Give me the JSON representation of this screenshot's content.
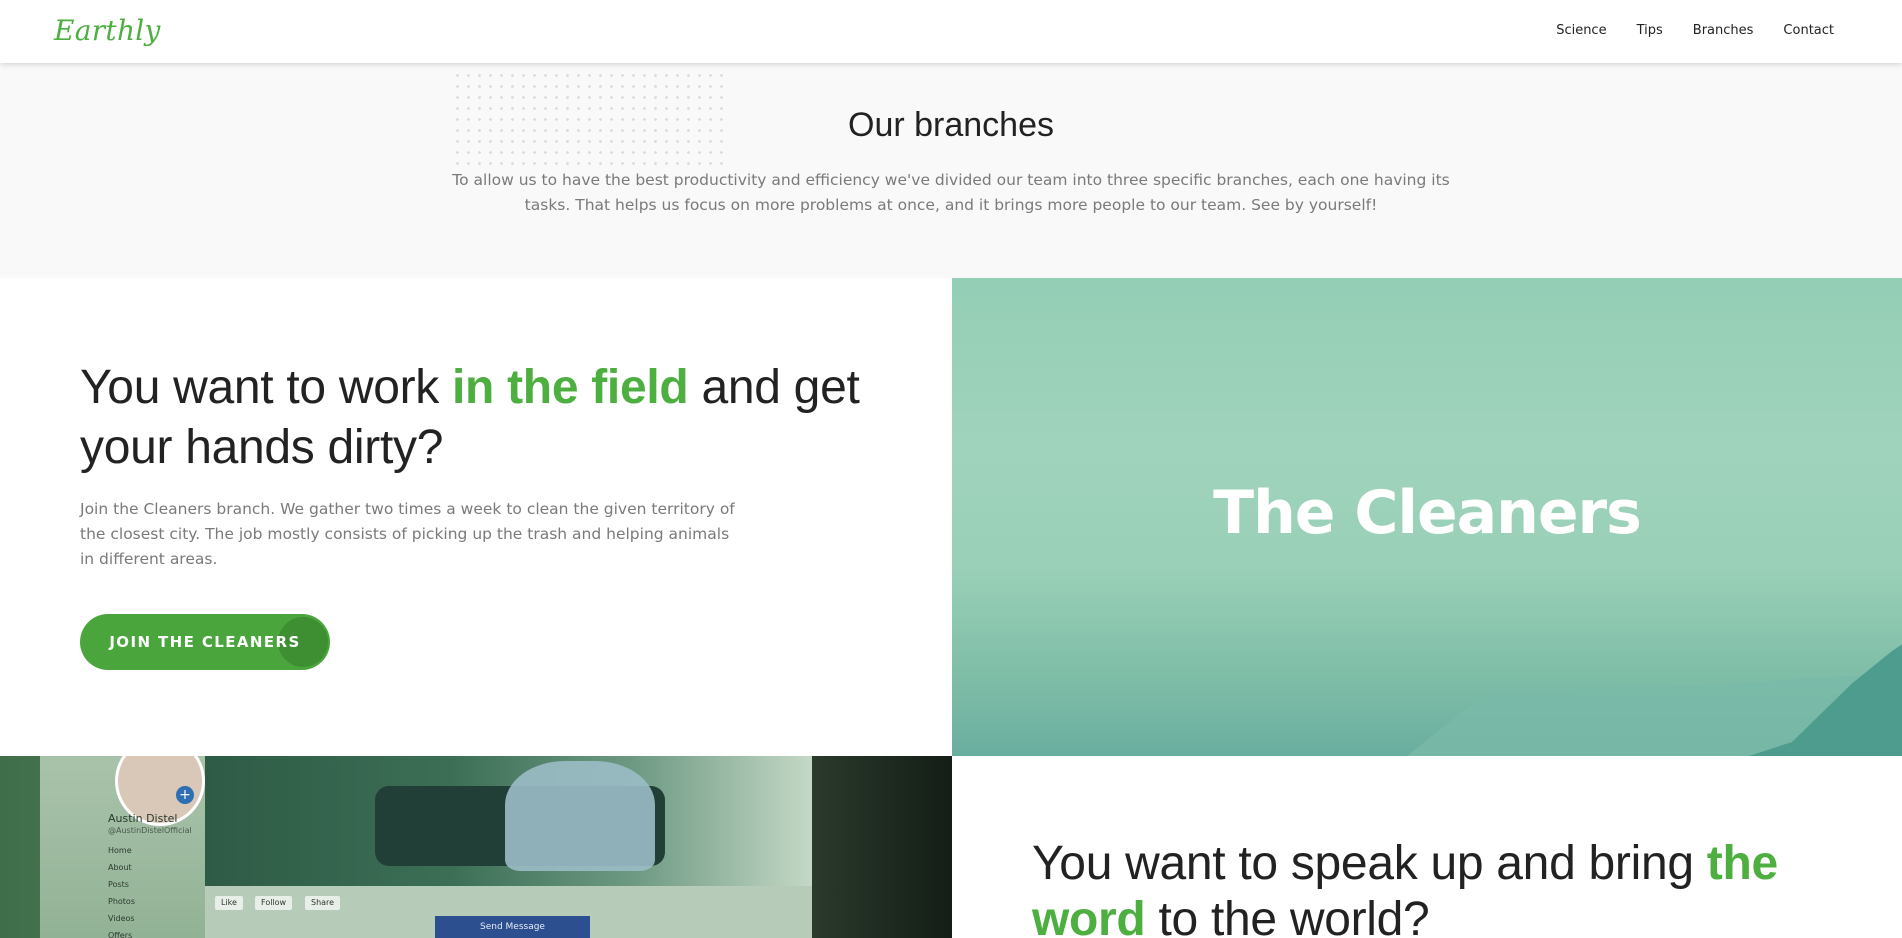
{
  "header": {
    "logo": "Earthly",
    "nav": [
      "Science",
      "Tips",
      "Branches",
      "Contact"
    ]
  },
  "intro": {
    "title": "Our branches",
    "text": "To allow us to have the best productivity and efficiency we've divided our team into three specific branches, each one having its tasks. That helps us focus on more problems at once, and it brings more people to our team. See by yourself!"
  },
  "cleaners": {
    "headline_before": "You want to work ",
    "headline_highlight": "in the field",
    "headline_after": " and get your hands dirty?",
    "text": "Join the Cleaners branch. We gather two times a week to clean the given territory of the closest city. The job mostly consists of picking up the trash and helping animals in different areas.",
    "button_label": "JOIN THE CLEANERS",
    "image_title": "The Cleaners"
  },
  "activists": {
    "headline_before": "You want to speak up and bring ",
    "headline_highlight": "the word",
    "headline_after": " to the world?",
    "image_profile_name": "Austin Distel",
    "image_profile_handle": "@AustinDistelOfficial",
    "image_menu": [
      "Home",
      "About",
      "Posts",
      "Photos",
      "Videos",
      "Offers"
    ],
    "image_actions": [
      "Like",
      "Follow",
      "Share"
    ],
    "image_send_message": "Send Message"
  },
  "colors": {
    "accent_green": "#4caf3f",
    "button_green": "#4aa63c",
    "image_teal": "#93ceb5"
  }
}
